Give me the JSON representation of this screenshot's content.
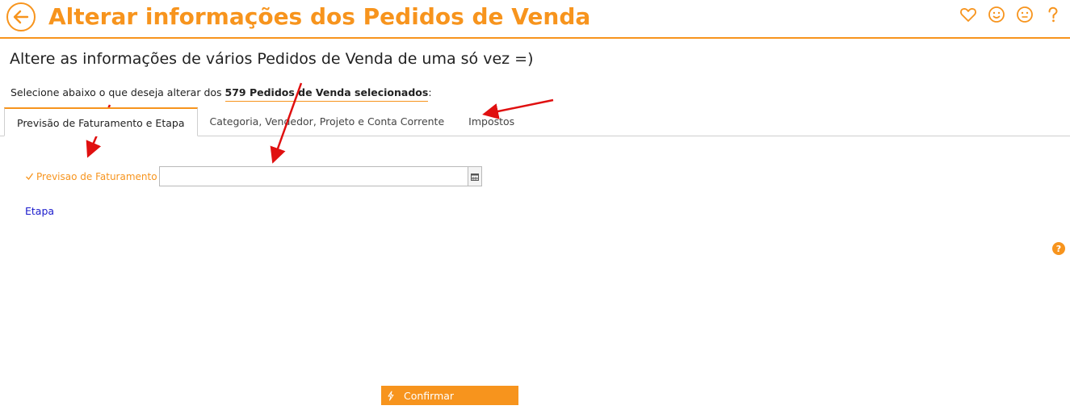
{
  "header": {
    "title": "Alterar informações dos Pedidos de Venda",
    "icons": [
      "heart-icon",
      "smile-icon",
      "neutral-face-icon",
      "question-icon"
    ]
  },
  "subtitle": "Altere as informações de vários Pedidos de Venda de uma só vez =)",
  "selection": {
    "prefix": "Selecione abaixo o que deseja alterar dos ",
    "count_text": "579 Pedidos de Venda selecionados",
    "suffix": ":"
  },
  "tabs": [
    {
      "label": "Previsão de Faturamento e Etapa",
      "active": true
    },
    {
      "label": "Categoria, Vendedor, Projeto e Conta Corrente",
      "active": false
    },
    {
      "label": "Impostos",
      "active": false
    }
  ],
  "form": {
    "previsao_label": "Previsao de Faturamento",
    "previsao_value": "",
    "etapa_label": "Etapa"
  },
  "confirm_label": "Confirmar",
  "colors": {
    "accent": "#f7941d",
    "link": "#1a1acc",
    "annotation_arrow": "#e01010"
  }
}
